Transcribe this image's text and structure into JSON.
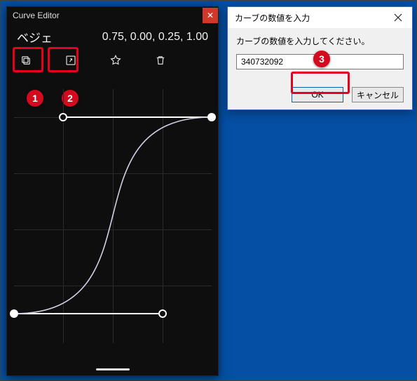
{
  "editor": {
    "title": "Curve Editor",
    "mode": "ベジェ",
    "coords": "0.75, 0.00, 0.25, 1.00",
    "icons": {
      "copy": "copy-icon",
      "code": "export-code-icon",
      "star": "favorite-icon",
      "trash": "delete-icon",
      "expand": "fullscreen-icon"
    }
  },
  "callouts": {
    "b1": "1",
    "b2": "2",
    "b3": "3"
  },
  "dialog": {
    "title": "カーブの数値を入力",
    "message": "カーブの数値を入力してください。",
    "value": "340732092",
    "ok": "OK",
    "cancel": "キャンセル"
  },
  "chart_data": {
    "type": "line",
    "title": "",
    "xlabel": "",
    "ylabel": "",
    "xlim": [
      0,
      1
    ],
    "ylim": [
      0,
      1
    ],
    "series": [
      {
        "name": "bezier",
        "bezier": {
          "p0": [
            0,
            0
          ],
          "c1": [
            0.75,
            0.0
          ],
          "c2": [
            0.25,
            1.0
          ],
          "p1": [
            1,
            1
          ]
        }
      }
    ],
    "handles": [
      {
        "role": "start",
        "x": 0,
        "y": 0
      },
      {
        "role": "c1",
        "x": 0.75,
        "y": 0
      },
      {
        "role": "c2",
        "x": 0.25,
        "y": 1
      },
      {
        "role": "end",
        "x": 1,
        "y": 1
      }
    ]
  }
}
